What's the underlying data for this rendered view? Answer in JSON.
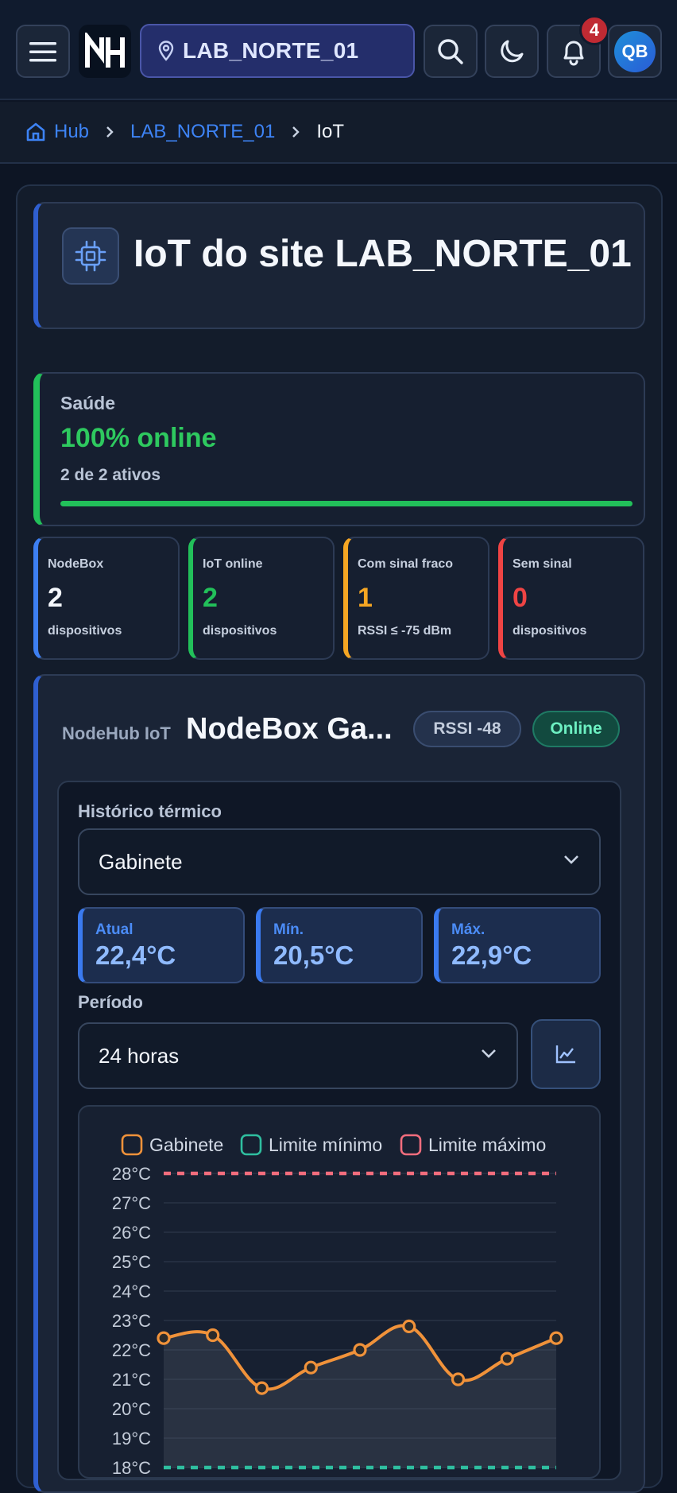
{
  "topbar": {
    "site": "LAB_NORTE_01",
    "notifications": "4",
    "avatar_initials": "QB"
  },
  "breadcrumb": {
    "home": "Hub",
    "site": "LAB_NORTE_01",
    "current": "IoT"
  },
  "page": {
    "title": "IoT do site LAB_NORTE_01"
  },
  "health": {
    "label": "Saúde",
    "value": "100% online",
    "sub": "2 de 2 ativos",
    "progress_percent": 100
  },
  "stats": [
    {
      "label": "NodeBox",
      "value": "2",
      "sub": "dispositivos",
      "color": "#3d7ff2"
    },
    {
      "label": "IoT online",
      "value": "2",
      "sub": "dispositivos",
      "color": "#22c05a"
    },
    {
      "label": "Com sinal fraco",
      "value": "1",
      "sub": "RSSI ≤ -75 dBm",
      "color": "#f5a623"
    },
    {
      "label": "Sem sinal",
      "value": "0",
      "sub": "dispositivos",
      "color": "#ef4444"
    }
  ],
  "device": {
    "kicker": "NodeHub IoT",
    "name": "NodeBox Ga...",
    "rssi": "RSSI -48",
    "status": "Online",
    "thermal": {
      "label": "Histórico térmico",
      "sensor": "Gabinete",
      "current_label": "Atual",
      "current": "22,4°C",
      "min_label": "Mín.",
      "min": "20,5°C",
      "max_label": "Máx.",
      "max": "22,9°C",
      "period_label": "Período",
      "period": "24 horas"
    }
  },
  "chart_data": {
    "type": "line",
    "legend": [
      "Gabinete",
      "Limite mínimo",
      "Limite máximo"
    ],
    "legend_position": "top",
    "y_ticks": [
      "28°C",
      "27°C",
      "26°C",
      "25°C",
      "24°C",
      "23°C",
      "22°C",
      "21°C",
      "20°C",
      "19°C",
      "18°C"
    ],
    "ylim": [
      18,
      28
    ],
    "grid": true,
    "series": [
      {
        "name": "Gabinete",
        "color": "#f0923a",
        "values": [
          22.4,
          22.5,
          20.7,
          21.4,
          22.0,
          22.8,
          21.0,
          21.7,
          22.4
        ]
      },
      {
        "name": "Limite mínimo",
        "color": "#2fbfa0",
        "values": [
          18,
          18,
          18,
          18,
          18,
          18,
          18,
          18,
          18
        ]
      },
      {
        "name": "Limite máximo",
        "color": "#f26d7d",
        "values": [
          28,
          28,
          28,
          28,
          28,
          28,
          28,
          28,
          28
        ]
      }
    ]
  }
}
